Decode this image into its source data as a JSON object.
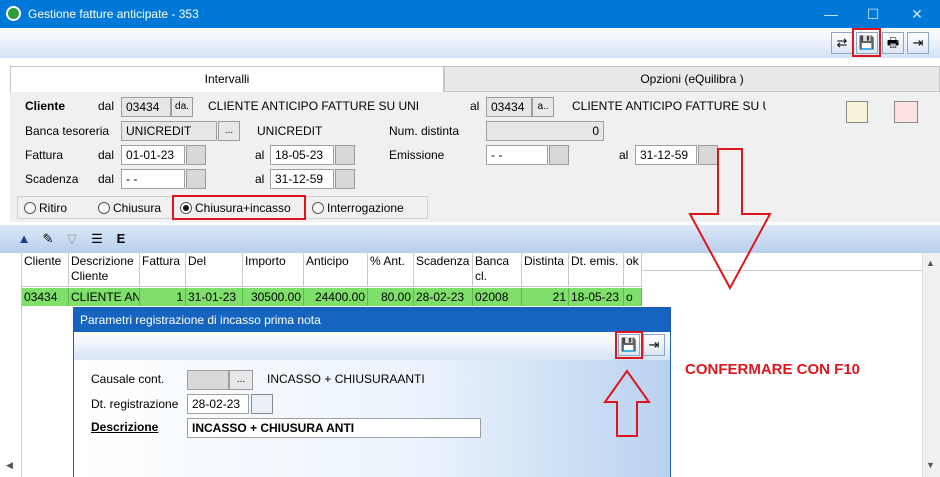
{
  "window": {
    "title": "Gestione fatture anticipate - 353",
    "minimize_glyph": "—",
    "maximize_glyph": "☐",
    "close_glyph": "✕"
  },
  "toolbar": {
    "refresh_icon": "⇄",
    "save_icon": "💾",
    "print_icon": "🖶",
    "exit_icon": "⇥"
  },
  "tabs": [
    {
      "label": "Intervalli",
      "active": true
    },
    {
      "label": "Opzioni (eQuilibra )",
      "active": false
    }
  ],
  "form": {
    "cliente_label": "Cliente",
    "dal_label": "dal",
    "al_label": "al",
    "cliente_from_code": "03434",
    "cliente_from_btn": "da.",
    "cliente_from_name": "CLIENTE ANTICIPO FATTURE SU UNI",
    "cliente_to_code": "03434",
    "cliente_to_btn": "a..",
    "cliente_to_name": "CLIENTE ANTICIPO FATTURE SU U",
    "banca_label": "Banca tesoreria",
    "banca_code": "UNICREDIT",
    "banca_btn": "...",
    "banca_name": "UNICREDIT",
    "num_distinta_label": "Num. distinta",
    "num_distinta_value": "0",
    "fattura_label": "Fattura",
    "fattura_from": "01-01-23",
    "fattura_to": "18-05-23",
    "emissione_label": "Emissione",
    "emissione_from": "- -",
    "emissione_to": "31-12-59",
    "scadenza_label": "Scadenza",
    "scadenza_from": "- -",
    "scadenza_to": "31-12-59",
    "radios": [
      {
        "label": "Ritiro",
        "checked": false
      },
      {
        "label": "Chiusura",
        "checked": false
      },
      {
        "label": "Chiusura+incasso",
        "checked": true
      },
      {
        "label": "Interrogazione",
        "checked": false
      }
    ]
  },
  "grid": {
    "toolbar_icons": [
      "up-arrow-icon",
      "edit-icon",
      "filter-icon",
      "list-icon",
      "export-icon"
    ],
    "columns": [
      "Cliente",
      "Descrizione Cliente",
      "Fattura",
      "Del",
      "Importo",
      "Anticipo",
      "% Ant.",
      "Scadenza",
      "Banca cl.",
      "Distinta",
      "Dt. emis.",
      "ok"
    ],
    "rows": [
      [
        "03434",
        "CLIENTE AN",
        "1",
        "31-01-23",
        "30500.00",
        "24400.00",
        "80.00",
        "28-02-23",
        "02008",
        "21",
        "18-05-23",
        "o"
      ]
    ]
  },
  "dialog": {
    "title": "Parametri registrazione di incasso prima nota",
    "causale_label": "Causale cont.",
    "causale_value": "",
    "causale_btn": "...",
    "causale_desc": "INCASSO + CHIUSURAANTI",
    "dt_label": "Dt. registrazione",
    "dt_value": "28-02-23",
    "descr_label": "Descrizione",
    "descr_value": "INCASSO + CHIUSURA ANTI"
  },
  "annotation": {
    "text": "CONFERMARE CON F10",
    "color": "#e0151b"
  }
}
